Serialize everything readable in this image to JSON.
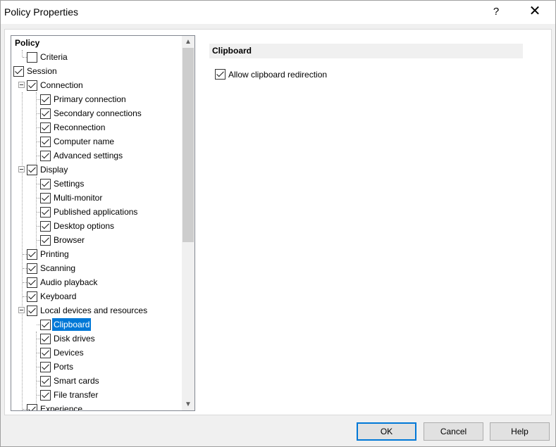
{
  "window": {
    "title": "Policy Properties",
    "help_glyph": "?",
    "close_glyph": "✕"
  },
  "tree": {
    "items": [
      {
        "label": "Policy",
        "checkbox": false,
        "bold": true
      },
      {
        "label": "Criteria",
        "checked": false
      },
      {
        "label": "Session",
        "checked": true
      },
      {
        "label": "Connection",
        "checked": true,
        "expanded": true
      },
      {
        "label": "Primary connection",
        "checked": true
      },
      {
        "label": "Secondary connections",
        "checked": true
      },
      {
        "label": "Reconnection",
        "checked": true
      },
      {
        "label": "Computer name",
        "checked": true
      },
      {
        "label": "Advanced settings",
        "checked": true
      },
      {
        "label": "Display",
        "checked": true,
        "expanded": true
      },
      {
        "label": "Settings",
        "checked": true
      },
      {
        "label": "Multi-monitor",
        "checked": true
      },
      {
        "label": "Published applications",
        "checked": true
      },
      {
        "label": "Desktop options",
        "checked": true
      },
      {
        "label": "Browser",
        "checked": true
      },
      {
        "label": "Printing",
        "checked": true
      },
      {
        "label": "Scanning",
        "checked": true
      },
      {
        "label": "Audio playback",
        "checked": true
      },
      {
        "label": "Keyboard",
        "checked": true
      },
      {
        "label": "Local devices and resources",
        "checked": true,
        "expanded": true
      },
      {
        "label": "Clipboard",
        "checked": true,
        "selected": true
      },
      {
        "label": "Disk drives",
        "checked": true
      },
      {
        "label": "Devices",
        "checked": true
      },
      {
        "label": "Ports",
        "checked": true
      },
      {
        "label": "Smart cards",
        "checked": true
      },
      {
        "label": "File transfer",
        "checked": true
      },
      {
        "label": "Experience",
        "checked": true
      }
    ]
  },
  "panel": {
    "header": "Clipboard",
    "option_label": "Allow clipboard redirection",
    "option_checked": true
  },
  "buttons": {
    "ok": "OK",
    "cancel": "Cancel",
    "help": "Help"
  },
  "colors": {
    "selection": "#0078d7",
    "default_button_border": "#0078d7"
  }
}
